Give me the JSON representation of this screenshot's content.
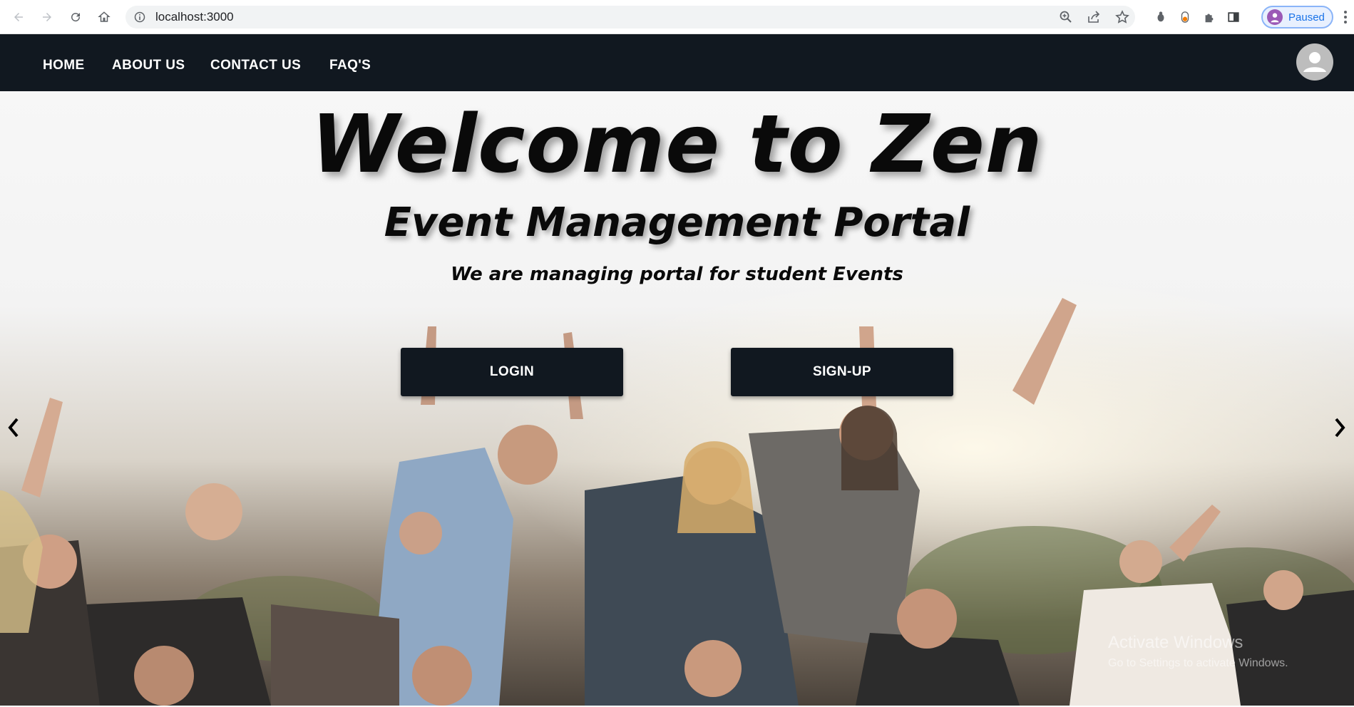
{
  "browser": {
    "url": "localhost:3000",
    "profile_status": "Paused",
    "icons": [
      "back-arrow-icon",
      "forward-arrow-icon",
      "reload-icon",
      "home-icon",
      "info-icon",
      "zoom-icon",
      "share-icon",
      "star-icon",
      "bug-extension-icon",
      "toggle-extension-icon",
      "puzzle-extensions-icon",
      "side-panel-icon",
      "kebab-menu-icon"
    ]
  },
  "navbar": {
    "links": [
      "HOME",
      "ABOUT US",
      "CONTACT US",
      "FAQ'S"
    ],
    "background": "#111820"
  },
  "hero": {
    "title": "Welcome to Zen",
    "subtitle": "Event Management Portal",
    "tagline": "We are managing portal for student Events",
    "login_label": "LOGIN",
    "signup_label": "SIGN-UP",
    "prev_icon": "chevron-left-icon",
    "next_icon": "chevron-right-icon"
  },
  "watermark": {
    "line1": "Activate Windows",
    "line2": "Go to Settings to activate Windows."
  }
}
